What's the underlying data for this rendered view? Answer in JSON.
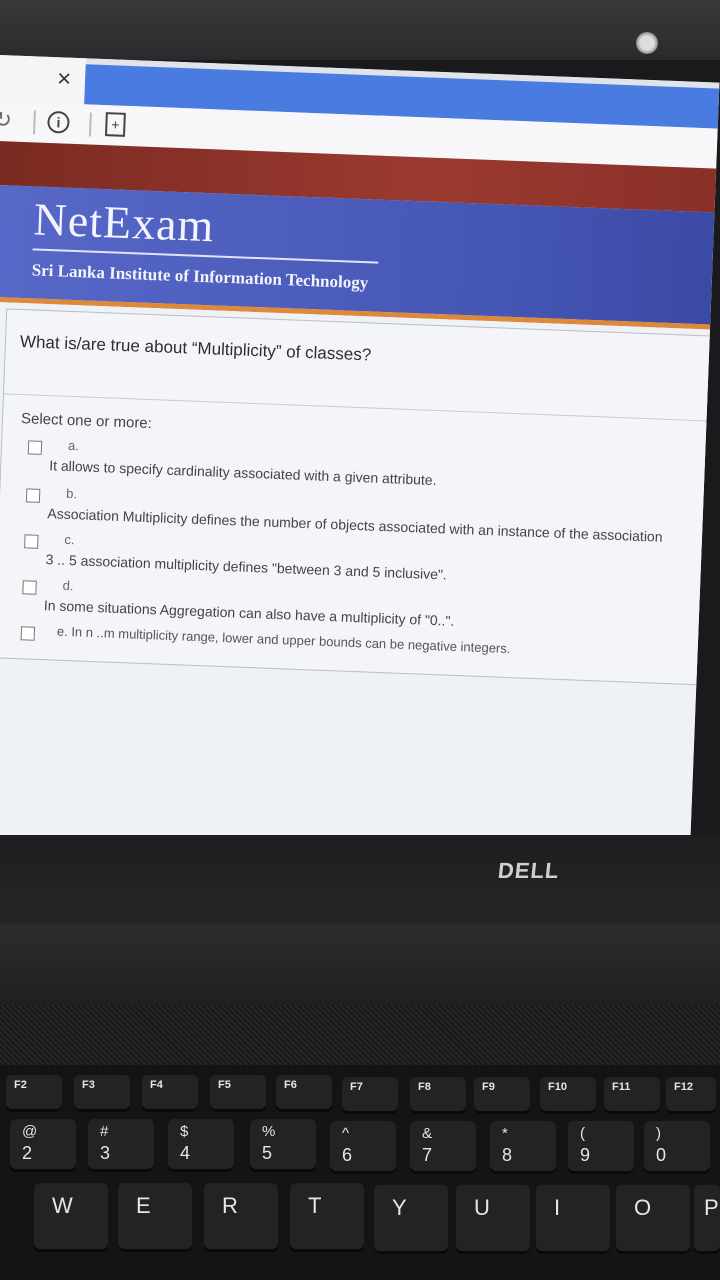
{
  "browser": {
    "close_glyph": "×",
    "reload_glyph": "↻",
    "info_glyph": "i",
    "doc_glyph": "+"
  },
  "header": {
    "logo": "NetExam",
    "subtitle": "Sri Lanka Institute of Information Technology"
  },
  "quiz": {
    "question": "What is/are true about “Multiplicity” of classes?",
    "instruction": "Select one or more:",
    "options": [
      {
        "letter": "a.",
        "text": "It allows to specify cardinality associated with a given attribute."
      },
      {
        "letter": "b.",
        "text": "Association Multiplicity defines the number of objects associated with an instance of the association"
      },
      {
        "letter": "c.",
        "text": "3 .. 5 association multiplicity defines \"between 3 and 5 inclusive\"."
      },
      {
        "letter": "d.",
        "text": "In some situations Aggregation can also have a multiplicity of \"0..\"."
      },
      {
        "letter": "e.",
        "text": "e. In n ..m  multiplicity range, lower and upper bounds can be negative integers."
      }
    ]
  },
  "laptop": {
    "brand": "DELL",
    "fkeys": [
      "F2",
      "F3",
      "F4",
      "F5",
      "F6",
      "F7",
      "F8",
      "F9",
      "F10",
      "F11",
      "F12"
    ],
    "numkeys": [
      {
        "up": "@",
        "dn": "2"
      },
      {
        "up": "#",
        "dn": "3"
      },
      {
        "up": "$",
        "dn": "4"
      },
      {
        "up": "%",
        "dn": "5"
      },
      {
        "up": "^",
        "dn": "6"
      },
      {
        "up": "&",
        "dn": "7"
      },
      {
        "up": "*",
        "dn": "8"
      },
      {
        "up": "(",
        "dn": "9"
      },
      {
        "up": ")",
        "dn": "0"
      }
    ],
    "letters": [
      "W",
      "E",
      "R",
      "T",
      "Y",
      "U",
      "I",
      "O",
      "P"
    ]
  }
}
